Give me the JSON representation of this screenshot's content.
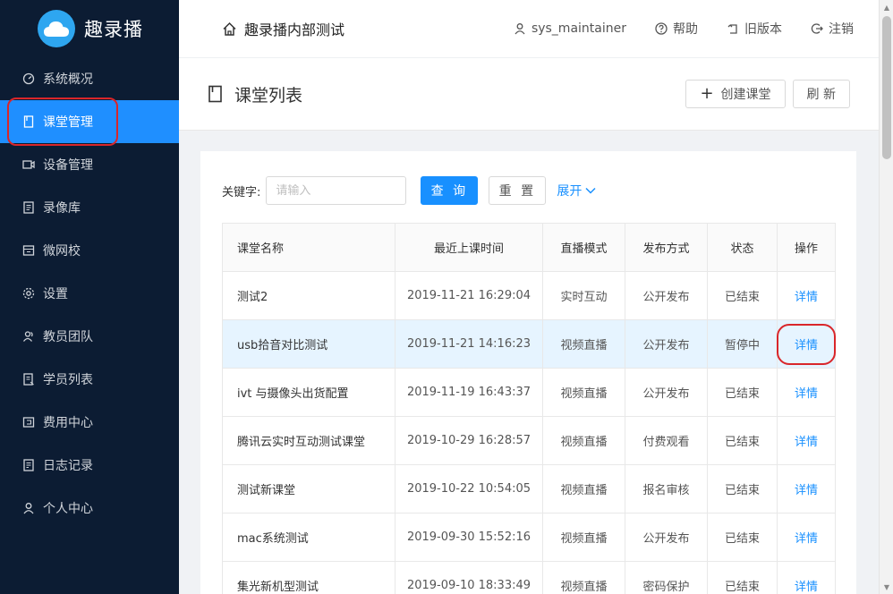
{
  "app": {
    "name": "趣录播"
  },
  "sidebar": {
    "items": [
      {
        "label": "系统概况",
        "icon": "dashboard-icon",
        "active": false
      },
      {
        "label": "课堂管理",
        "icon": "book-icon",
        "active": true
      },
      {
        "label": "设备管理",
        "icon": "camera-icon",
        "active": false
      },
      {
        "label": "录像库",
        "icon": "video-library-icon",
        "active": false
      },
      {
        "label": "微网校",
        "icon": "school-icon",
        "active": false
      },
      {
        "label": "设置",
        "icon": "gear-icon",
        "active": false
      },
      {
        "label": "教员团队",
        "icon": "team-icon",
        "active": false
      },
      {
        "label": "学员列表",
        "icon": "student-list-icon",
        "active": false
      },
      {
        "label": "费用中心",
        "icon": "billing-icon",
        "active": false
      },
      {
        "label": "日志记录",
        "icon": "log-icon",
        "active": false
      },
      {
        "label": "个人中心",
        "icon": "user-icon",
        "active": false
      }
    ]
  },
  "topbar": {
    "breadcrumb": "趣录播内部测试",
    "user": "sys_maintainer",
    "help": "帮助",
    "old_version": "旧版本",
    "logout": "注销"
  },
  "page": {
    "title": "课堂列表",
    "create_label": "创建课堂",
    "refresh_label": "刷 新"
  },
  "filter": {
    "label": "关键字:",
    "placeholder": "请输入",
    "search_label": "查 询",
    "reset_label": "重 置",
    "expand_label": "展开"
  },
  "table": {
    "headers": [
      "课堂名称",
      "最近上课时间",
      "直播模式",
      "发布方式",
      "状态",
      "操作"
    ],
    "rows": [
      {
        "name": "测试2",
        "time": "2019-11-21 16:29:04",
        "mode": "实时互动",
        "publish": "公开发布",
        "status": "已结束",
        "action": "详情"
      },
      {
        "name": "usb拾音对比测试",
        "time": "2019-11-21 14:16:23",
        "mode": "视频直播",
        "publish": "公开发布",
        "status": "暂停中",
        "action": "详情"
      },
      {
        "name": "ivt 与摄像头出货配置",
        "time": "2019-11-19 16:43:37",
        "mode": "视频直播",
        "publish": "公开发布",
        "status": "已结束",
        "action": "详情"
      },
      {
        "name": "腾讯云实时互动测试课堂",
        "time": "2019-10-29 16:28:57",
        "mode": "视频直播",
        "publish": "付费观看",
        "status": "已结束",
        "action": "详情"
      },
      {
        "name": "测试新课堂",
        "time": "2019-10-22 10:54:05",
        "mode": "视频直播",
        "publish": "报名审核",
        "status": "已结束",
        "action": "详情"
      },
      {
        "name": "mac系统测试",
        "time": "2019-09-30 15:52:16",
        "mode": "视频直播",
        "publish": "公开发布",
        "status": "已结束",
        "action": "详情"
      },
      {
        "name": "集光新机型测试",
        "time": "2019-09-10 18:33:49",
        "mode": "视频直播",
        "publish": "密码保护",
        "status": "已结束",
        "action": "详情"
      }
    ]
  },
  "colors": {
    "sidebar_bg": "#0c1c33",
    "accent": "#1890ff",
    "highlight_row": "#e6f4ff",
    "annotation": "#d9262a"
  }
}
